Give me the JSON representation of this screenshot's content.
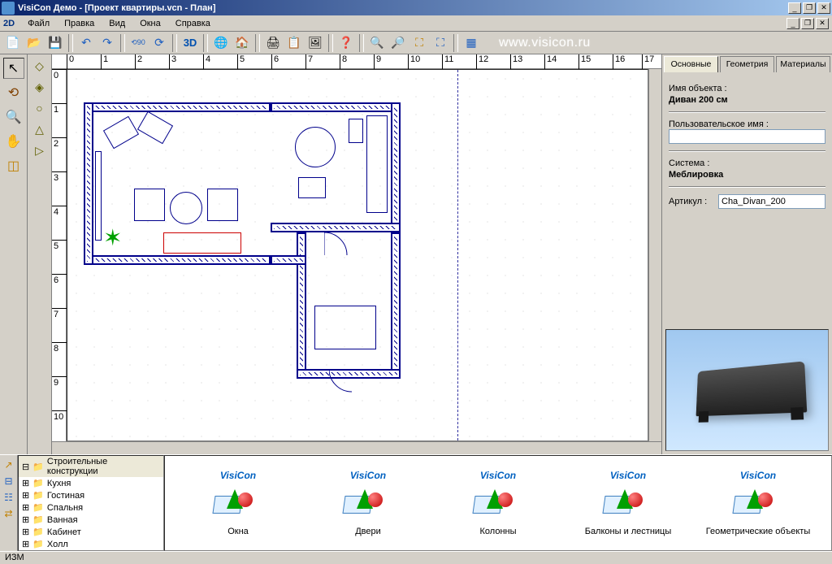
{
  "titlebar": {
    "title": "VisiCon Демо - [Проект квартиры.vcn - План]"
  },
  "menubar": {
    "mode": "2D",
    "items": [
      "Файл",
      "Правка",
      "Вид",
      "Окна",
      "Справка"
    ]
  },
  "toolbar": {
    "mode3d": "3D",
    "url": "www.visicon.ru"
  },
  "ruler_h": [
    "0",
    "1",
    "2",
    "3",
    "4",
    "5",
    "6",
    "7",
    "8",
    "9",
    "10",
    "11",
    "12",
    "13",
    "14",
    "15",
    "16",
    "17"
  ],
  "ruler_v": [
    "0",
    "1",
    "2",
    "3",
    "4",
    "5",
    "6",
    "7",
    "8",
    "9",
    "10"
  ],
  "properties": {
    "tabs": [
      "Основные",
      "Геометрия",
      "Материалы"
    ],
    "object_name_label": "Имя объекта :",
    "object_name_value": "Диван 200 см",
    "custom_name_label": "Пользовательское имя :",
    "custom_name_value": "",
    "system_label": "Система :",
    "system_value": "Меблировка",
    "article_label": "Артикул :",
    "article_value": "Cha_Divan_200"
  },
  "catalog": {
    "tree": [
      "Строительные конструкции",
      "Кухня",
      "Гостиная",
      "Спальня",
      "Ванная",
      "Кабинет",
      "Холл"
    ],
    "selected_tree": 0,
    "items": [
      {
        "brand": "VisiCon",
        "caption": "Окна"
      },
      {
        "brand": "VisiCon",
        "caption": "Двери"
      },
      {
        "brand": "VisiCon",
        "caption": "Колонны"
      },
      {
        "brand": "VisiCon",
        "caption": "Балконы и лестницы"
      },
      {
        "brand": "VisiCon",
        "caption": "Геометрические объекты"
      }
    ]
  },
  "statusbar": {
    "text": "ИЗМ"
  }
}
